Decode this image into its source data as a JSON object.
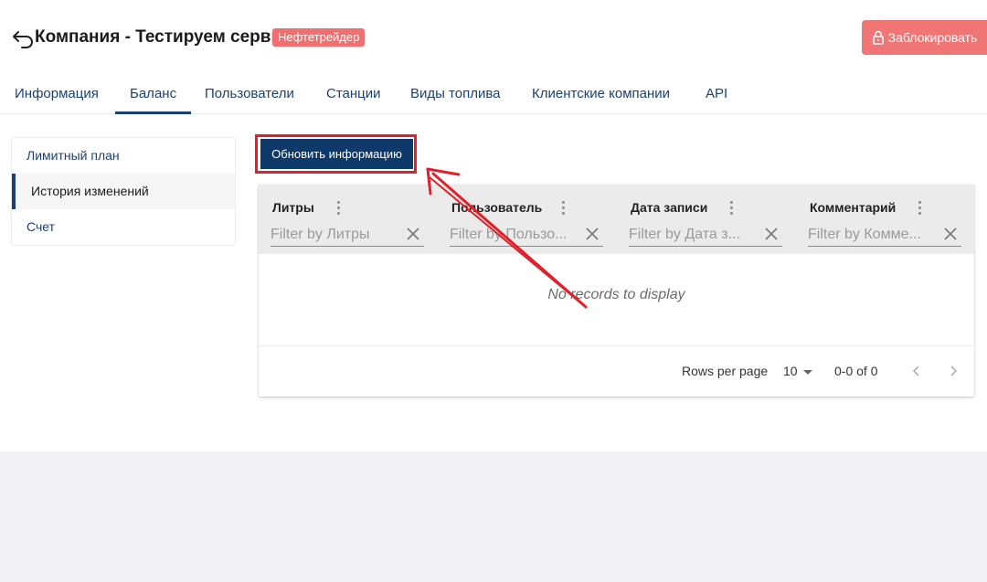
{
  "header": {
    "title": "Компания - Тестируем сервис",
    "badge": "Нефтетрейдер",
    "block_button": "Заблокировать"
  },
  "tabs": [
    {
      "label": "Информация"
    },
    {
      "label": "Баланс",
      "active": true
    },
    {
      "label": "Пользователи"
    },
    {
      "label": "Станции"
    },
    {
      "label": "Виды топлива"
    },
    {
      "label": "Клиентские компании"
    },
    {
      "label": "API"
    }
  ],
  "side_menu": [
    {
      "label": "Лимитный план"
    },
    {
      "label": "История изменений",
      "active": true
    },
    {
      "label": "Счет"
    }
  ],
  "refresh_button": "Обновить информацию",
  "grid": {
    "columns": [
      {
        "title": "Литры",
        "filter_placeholder": "Filter by Литры"
      },
      {
        "title": "Пользователь",
        "filter_placeholder": "Filter by Пользо..."
      },
      {
        "title": "Дата записи",
        "filter_placeholder": "Filter by Дата з..."
      },
      {
        "title": "Комментарий",
        "filter_placeholder": "Filter by Комме..."
      }
    ],
    "empty_text": "No records to display",
    "footer": {
      "rows_per_page_label": "Rows per page",
      "rows_per_page_value": "10",
      "range": "0-0 of 0"
    }
  },
  "colors": {
    "accent": "#1a4173",
    "danger": "#f07676",
    "button_primary": "#0e3a6b",
    "highlight": "#e0202a"
  },
  "icons": [
    "back-arrow-icon",
    "lock-icon",
    "column-menu-icon",
    "clear-icon",
    "sort-caret-icon",
    "chevron-left-icon",
    "chevron-right-icon"
  ]
}
